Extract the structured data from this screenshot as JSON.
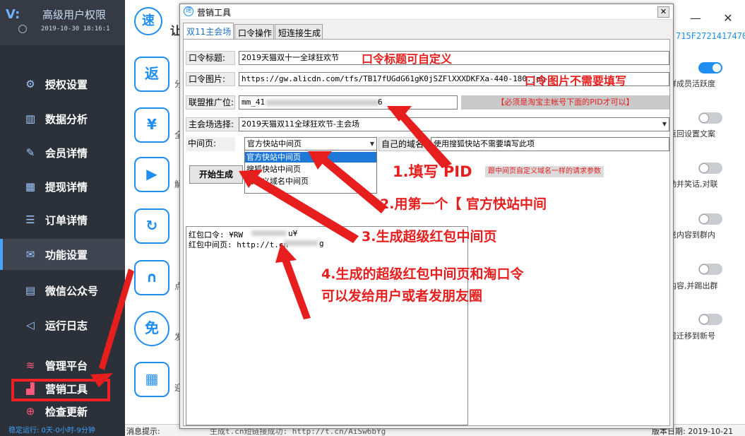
{
  "sidebar": {
    "logo": "V:",
    "title": "高级用户权限",
    "date": "2019-10-30 18:16:1",
    "items": [
      {
        "label": "授权设置",
        "icon": "⚙"
      },
      {
        "label": "数据分析",
        "icon": "▥"
      },
      {
        "label": "会员详情",
        "icon": "✎"
      },
      {
        "label": "提现详情",
        "icon": "▦"
      },
      {
        "label": "订单详情",
        "icon": "☰"
      },
      {
        "label": "功能设置",
        "icon": "✉"
      },
      {
        "label": "微信公众号",
        "icon": "▤"
      },
      {
        "label": "运行日志",
        "icon": "◁"
      },
      {
        "label": "管理平台",
        "icon": "≋"
      },
      {
        "label": "营销工具",
        "icon": "▟"
      },
      {
        "label": "检查更新",
        "icon": "⊕"
      }
    ],
    "status": "稳定运行: 0天-0小时-9分钟"
  },
  "main": {
    "top_logo": "速",
    "top_letter": "让",
    "serial": "715F2721417470",
    "side_icons": [
      {
        "glyph": "返",
        "text": "分"
      },
      {
        "glyph": "¥",
        "text": "全"
      },
      {
        "glyph": "▶",
        "text": "解"
      },
      {
        "glyph": "↻",
        "text": ""
      },
      {
        "glyph": "∩",
        "text": "点"
      },
      {
        "glyph": "免",
        "text": "发"
      },
      {
        "glyph": "▦",
        "text": "迎"
      }
    ],
    "right_texts": [
      "群成员活跃度",
      "返回设置文案",
      "动并笑话,对联",
      "送内容到群内",
      "内容,并踢出群",
      "居迁移到新号"
    ],
    "status_left": "消息提示:",
    "status_mid": "生成t.cn短链接成功: http://t.cn/AiSw6bYg",
    "status_right": "版本日期: 2019-10-21",
    "win_min": "—",
    "win_close": "✕"
  },
  "dialog": {
    "title": "营销工具",
    "close": "✕",
    "tabs": [
      "双11主会场",
      "口令操作",
      "短连接生成"
    ],
    "fields": {
      "title_label": "口令标题:",
      "title_value": "2019天猫双十一全球狂欢节",
      "image_label": "口令图片:",
      "image_value": "https://gw.alicdn.com/tfs/TB17fUGdG61gK0jSZFlXXXDKFXa-440-180.jpg",
      "pid_label": "联盟推广位:",
      "pid_value": "mm_41",
      "pid_value_end": "6",
      "venue_label": "主会场选择:",
      "venue_value": "2019天猫双11全球狂欢节-主会场",
      "mid_label": "中间页:",
      "mid_value": "官方快站中间页",
      "domain_label": "自己的域名:",
      "domain_value": "使用搜狐快站不需要填写此项",
      "generate": "开始生成",
      "pid_note": "【必须是淘宝主帐号下面的PID才可以】",
      "mid_note": "跟中间页自定义域名一样的请求参数"
    },
    "dropdown": [
      "官方快站中间页",
      "搜狐快站中间页",
      "自定义域名中间页"
    ],
    "output": {
      "line1": "红包口令: ¥RW",
      "line1_end": "u¥",
      "line2": "红包中间页: http://t.cn",
      "line2_end": "g"
    }
  },
  "annotations": {
    "a_title": "口令标题可自定义",
    "a_image": "口令图片不需要填写",
    "a1": "1.填写 PID",
    "a2": "2.用第一个【 官方快站中间",
    "a3": "3.生成超级红包中间页",
    "a4_line1": "4.生成的超级红包中间页和淘口令",
    "a4_line2": "可以发给用户或者发朋友圈",
    "arrow_color": "#e61e1e"
  }
}
